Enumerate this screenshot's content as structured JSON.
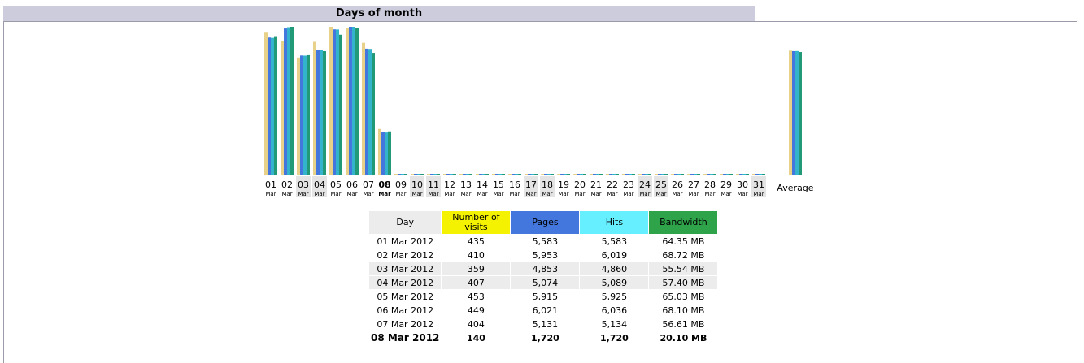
{
  "section_title": "Days of month",
  "average_label": "Average",
  "colors": {
    "visits": "#e8d28a",
    "pages": "#4477dd",
    "hits": "#33b3cc",
    "bandwidth": "#229977"
  },
  "chart_data": {
    "type": "bar",
    "title": "Days of month",
    "categories": [
      "01",
      "02",
      "03",
      "04",
      "05",
      "06",
      "07",
      "08",
      "09",
      "10",
      "11",
      "12",
      "13",
      "14",
      "15",
      "16",
      "17",
      "18",
      "19",
      "20",
      "21",
      "22",
      "23",
      "24",
      "25",
      "26",
      "27",
      "28",
      "29",
      "30",
      "31"
    ],
    "month_label": "Mar",
    "weekend_days": [
      "03",
      "04",
      "10",
      "11",
      "17",
      "18",
      "24",
      "25",
      "31"
    ],
    "highlight_day": "08",
    "series": [
      {
        "name": "Number of visits",
        "values": [
          435,
          410,
          359,
          407,
          453,
          449,
          404,
          140,
          0,
          0,
          0,
          0,
          0,
          0,
          0,
          0,
          0,
          0,
          0,
          0,
          0,
          0,
          0,
          0,
          0,
          0,
          0,
          0,
          0,
          0,
          0
        ],
        "average": 380
      },
      {
        "name": "Pages",
        "values": [
          5583,
          5953,
          4853,
          5074,
          5915,
          6021,
          5131,
          1720,
          0,
          0,
          0,
          0,
          0,
          0,
          0,
          0,
          0,
          0,
          0,
          0,
          0,
          0,
          0,
          0,
          0,
          0,
          0,
          0,
          0,
          0,
          0
        ],
        "average": 5031
      },
      {
        "name": "Hits",
        "values": [
          5583,
          6019,
          4860,
          5089,
          5925,
          6036,
          5134,
          1720,
          0,
          0,
          0,
          0,
          0,
          0,
          0,
          0,
          0,
          0,
          0,
          0,
          0,
          0,
          0,
          0,
          0,
          0,
          0,
          0,
          0,
          0,
          0
        ],
        "average": 5046
      },
      {
        "name": "Bandwidth",
        "values": [
          64.35,
          68.72,
          55.54,
          57.4,
          65.03,
          68.1,
          56.61,
          20.1,
          0,
          0,
          0,
          0,
          0,
          0,
          0,
          0,
          0,
          0,
          0,
          0,
          0,
          0,
          0,
          0,
          0,
          0,
          0,
          0,
          0,
          0,
          0
        ],
        "average": 57.0
      }
    ]
  },
  "table": {
    "headers": {
      "day": "Day",
      "visits_line1": "Number of",
      "visits_line2": "visits",
      "pages": "Pages",
      "hits": "Hits",
      "bandwidth": "Bandwidth"
    },
    "rows": [
      {
        "day": "01 Mar 2012",
        "visits": "435",
        "pages": "5,583",
        "hits": "5,583",
        "bandwidth": "64.35 MB"
      },
      {
        "day": "02 Mar 2012",
        "visits": "410",
        "pages": "5,953",
        "hits": "6,019",
        "bandwidth": "68.72 MB"
      },
      {
        "day": "03 Mar 2012",
        "visits": "359",
        "pages": "4,853",
        "hits": "4,860",
        "bandwidth": "55.54 MB"
      },
      {
        "day": "04 Mar 2012",
        "visits": "407",
        "pages": "5,074",
        "hits": "5,089",
        "bandwidth": "57.40 MB"
      },
      {
        "day": "05 Mar 2012",
        "visits": "453",
        "pages": "5,915",
        "hits": "5,925",
        "bandwidth": "65.03 MB"
      },
      {
        "day": "06 Mar 2012",
        "visits": "449",
        "pages": "6,021",
        "hits": "6,036",
        "bandwidth": "68.10 MB"
      },
      {
        "day": "07 Mar 2012",
        "visits": "404",
        "pages": "5,131",
        "hits": "5,134",
        "bandwidth": "56.61 MB"
      },
      {
        "day": "08 Mar 2012",
        "visits": "140",
        "pages": "1,720",
        "hits": "1,720",
        "bandwidth": "20.10 MB"
      }
    ]
  }
}
